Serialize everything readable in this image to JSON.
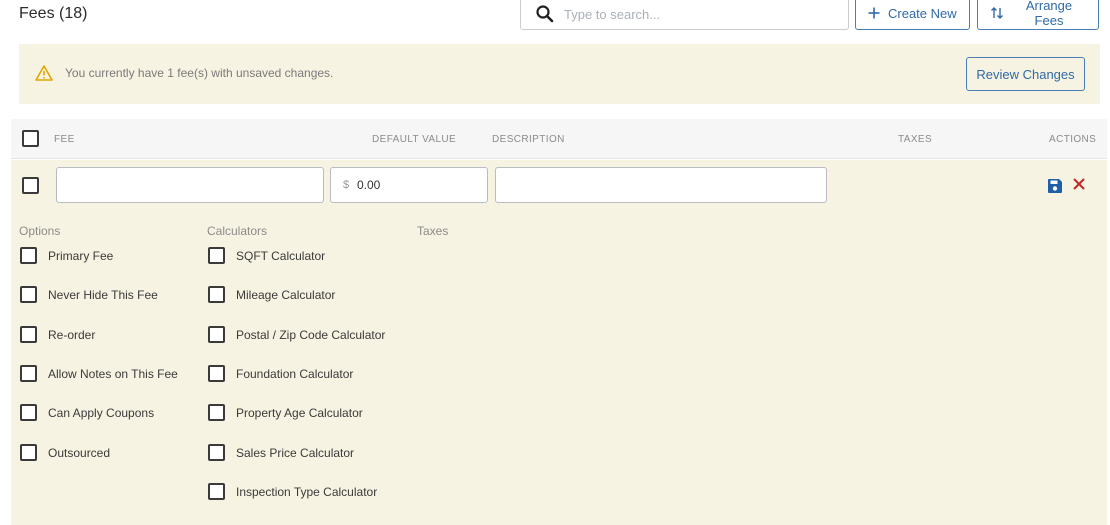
{
  "header": {
    "title": "Fees (18)",
    "search_placeholder": "Type to search...",
    "create_label": "Create New",
    "arrange_label": "Arrange Fees"
  },
  "banner": {
    "message": "You currently have 1 fee(s) with unsaved changes.",
    "review_label": "Review Changes"
  },
  "table": {
    "columns": {
      "fee": "FEE",
      "default_value": "DEFAULT VALUE",
      "description": "DESCRIPTION",
      "taxes": "TAXES",
      "actions": "ACTIONS"
    }
  },
  "edit_row": {
    "fee_name": "",
    "currency_symbol": "$",
    "default_value": "0.00",
    "description": ""
  },
  "sections": {
    "options_label": "Options",
    "calculators_label": "Calculators",
    "taxes_label": "Taxes"
  },
  "options": [
    {
      "label": "Primary Fee",
      "checked": false
    },
    {
      "label": "Never Hide This Fee",
      "checked": false
    },
    {
      "label": "Re-order",
      "checked": false
    },
    {
      "label": "Allow Notes on This Fee",
      "checked": false
    },
    {
      "label": "Can Apply Coupons",
      "checked": false
    },
    {
      "label": "Outsourced",
      "checked": false
    }
  ],
  "calculators": [
    {
      "label": "SQFT Calculator",
      "checked": false
    },
    {
      "label": "Mileage Calculator",
      "checked": false
    },
    {
      "label": "Postal / Zip Code Calculator",
      "checked": false
    },
    {
      "label": "Foundation Calculator",
      "checked": false
    },
    {
      "label": "Property Age Calculator",
      "checked": false
    },
    {
      "label": "Sales Price Calculator",
      "checked": false
    },
    {
      "label": "Inspection Type Calculator",
      "checked": false
    }
  ],
  "colors": {
    "accent": "#2f6aa6",
    "banner_bg": "#f7f3e2",
    "warning": "#e0a800",
    "save": "#1f5fa8",
    "delete": "#c62828"
  },
  "icons": {
    "search": "search-icon",
    "create": "plus-icon",
    "arrange": "sort-arrows-icon",
    "warning": "warning-triangle-icon",
    "save": "floppy-disk-icon",
    "delete": "close-icon"
  }
}
